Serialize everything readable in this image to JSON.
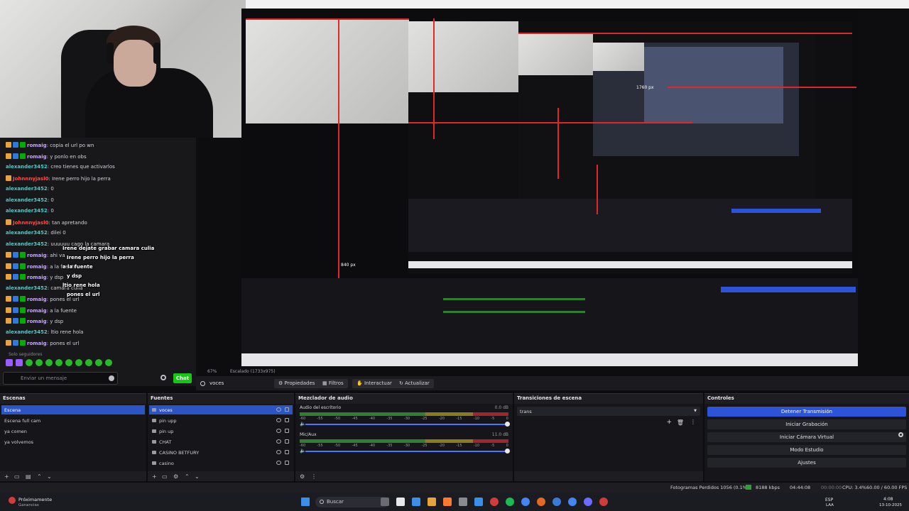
{
  "chat": {
    "messages": [
      {
        "user": "romaig",
        "text": ": copia el url po wn",
        "color": "purple",
        "badges": 3
      },
      {
        "user": "romaig",
        "text": ": y ponlo en obs",
        "color": "purple",
        "badges": 3
      },
      {
        "user": "alexander3452",
        "text": ": creo tienes que activarlos",
        "color": "teal",
        "badges": 0
      },
      {
        "user": "Johnnnyjasl0",
        "text": ": Irene perro hijo la perra",
        "color": "red",
        "badges": 1
      },
      {
        "user": "alexander3452",
        "text": ": 0",
        "color": "teal",
        "badges": 0
      },
      {
        "user": "alexander3452",
        "text": ": 0",
        "color": "teal",
        "badges": 0
      },
      {
        "user": "alexander3452",
        "text": ": 0",
        "color": "teal",
        "badges": 0
      },
      {
        "user": "Johnnnyjasl0",
        "text": ": tan apretando",
        "color": "red",
        "badges": 1
      },
      {
        "user": "alexander3452",
        "text": ": dilei 0",
        "color": "teal",
        "badges": 0
      },
      {
        "user": "alexander3452",
        "text": ": uuuuuu cago la camara",
        "color": "teal",
        "badges": 0
      },
      {
        "user": "romaig",
        "text": ": ahi va",
        "color": "purple",
        "badges": 3
      },
      {
        "user": "romaig",
        "text": ": a la fuente",
        "color": "purple",
        "badges": 3
      },
      {
        "user": "romaig",
        "text": ": y dsp",
        "color": "purple",
        "badges": 3
      },
      {
        "user": "alexander3452",
        "text": ": camara culia",
        "color": "teal",
        "badges": 0
      },
      {
        "user": "romaig",
        "text": ": pones el url",
        "color": "purple",
        "badges": 3
      },
      {
        "user": "romaig",
        "text": ": a la fuente",
        "color": "purple",
        "badges": 3
      },
      {
        "user": "romaig",
        "text": ": y dsp",
        "color": "purple",
        "badges": 3
      },
      {
        "user": "alexander3452",
        "text": ": ltio rene hola",
        "color": "teal",
        "badges": 0
      },
      {
        "user": "romaig",
        "text": ": pones el url",
        "color": "purple",
        "badges": 3
      }
    ],
    "overlay_lines": [
      "Irene dejate grabar camara culia",
      "Irene perro hijo la perra",
      "a la fuente",
      "y dsp",
      "ltio rene hola",
      "pones el url"
    ],
    "followers_only": "Solo seguidores",
    "input_placeholder": "Enviar un mensaje",
    "chat_button": "Chat"
  },
  "preview": {
    "resolution_label": "840 px",
    "nested_label": "1760 px"
  },
  "toolbar": {
    "zoom": "67%",
    "scaling": "Escalado (1733x975)",
    "scene_name": "voces",
    "properties": "Propiedades",
    "filters": "Filtros",
    "interact": "Interactuar",
    "refresh": "Actualizar"
  },
  "scenes": {
    "title": "Escenas",
    "items": [
      "Escena",
      "Escena full cam",
      "ya comen",
      "ya volvemos"
    ],
    "selected": 0
  },
  "sources": {
    "title": "Fuentes",
    "items": [
      "voces",
      "pin upp",
      "pin up",
      "CHAT",
      "CASINO BETFURY",
      "casino"
    ],
    "selected": 0
  },
  "mixer": {
    "title": "Mezclador de audio",
    "channels": [
      {
        "name": "Audio del escritorio",
        "db": "0.0 dB"
      },
      {
        "name": "Mic/Aux",
        "db": "11.0 dB"
      }
    ],
    "scale": [
      "-60",
      "-55",
      "-50",
      "-45",
      "-40",
      "-35",
      "-30",
      "-25",
      "-20",
      "-15",
      "-10",
      "-5",
      "0"
    ]
  },
  "transitions": {
    "title": "Transiciones de escena",
    "current": "trans"
  },
  "controls": {
    "title": "Controles",
    "buttons": [
      "Detener Transmisión",
      "Iniciar Grabación",
      "Iniciar Cámara Virtual",
      "Modo Estudio",
      "Ajustes"
    ]
  },
  "status": {
    "dropped": "Fotogramas Perdidos 1056 (0.1%)",
    "bitrate": "8188 kbps",
    "stream_time": "04:44:08",
    "rec_time": "00:00:00",
    "cpu": "CPU: 3.4%",
    "fps": "60.00 / 60.00 FPS"
  },
  "taskbar": {
    "weather_title": "Próximamente",
    "weather_sub": "Ganancias",
    "search": "Buscar",
    "lang": "ESP",
    "lang_sub": "LAA",
    "time": "4:08",
    "date": "13-10-2025"
  },
  "colors": {
    "accent_blue": "#2d54d8",
    "twitch_green": "#16c716",
    "red_guides": "#e0272b"
  }
}
